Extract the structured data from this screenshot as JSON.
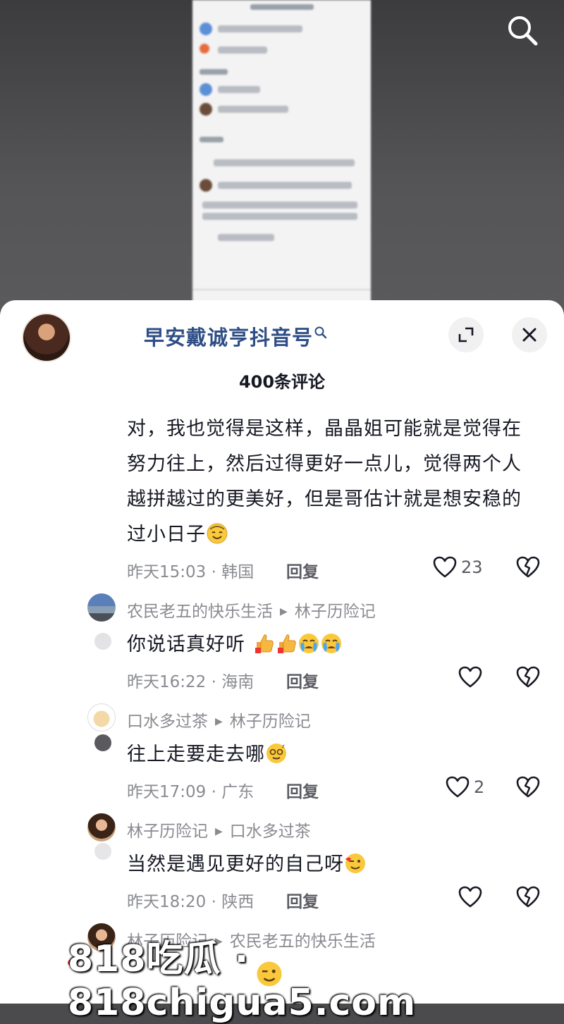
{
  "header": {
    "owner_name": "早安戴诚亨抖音号",
    "comment_count": "400条评论"
  },
  "main_comment": {
    "text": "对，我也觉得是这样，晶晶姐可能就是觉得在努力往上，然后过得更好一点儿，觉得两个人越拼越过的更美好，但是哥估计就是想安稳的过小日子",
    "meta": "昨天15:03 · 韩国",
    "reply_label": "回复",
    "likes": "23"
  },
  "replies": [
    {
      "author": "农民老五的快乐生活",
      "reply_to": "林子历险记",
      "text": "你说话真好听",
      "meta": "昨天16:22 · 海南",
      "reply_label": "回复",
      "likes": ""
    },
    {
      "author": "口水多过茶",
      "reply_to": "林子历险记",
      "text": "往上走要走去哪",
      "meta": "昨天17:09 · 广东",
      "reply_label": "回复",
      "likes": "2"
    },
    {
      "author": "林子历险记",
      "reply_to": "口水多过茶",
      "text": "当然是遇见更好的自己呀",
      "meta": "昨天18:20 · 陕西",
      "reply_label": "回复",
      "likes": ""
    },
    {
      "author": "林子历险记",
      "reply_to": "农民老五的快乐生活",
      "text": "",
      "meta": "",
      "reply_label": "",
      "likes": ""
    }
  ],
  "watermark": "818吃瓜 · 818chigua5.com",
  "colors": {
    "owner_name": "#2f4e86",
    "meta_gray": "#8a8b91",
    "text": "#161823",
    "sheet_bg": "#ffffff"
  },
  "icons": [
    "search-icon",
    "expand-icon",
    "close-icon",
    "heart-icon",
    "broken-heart-icon",
    "smile-emoji",
    "thumbs-up-emoji",
    "crying-emoji"
  ]
}
